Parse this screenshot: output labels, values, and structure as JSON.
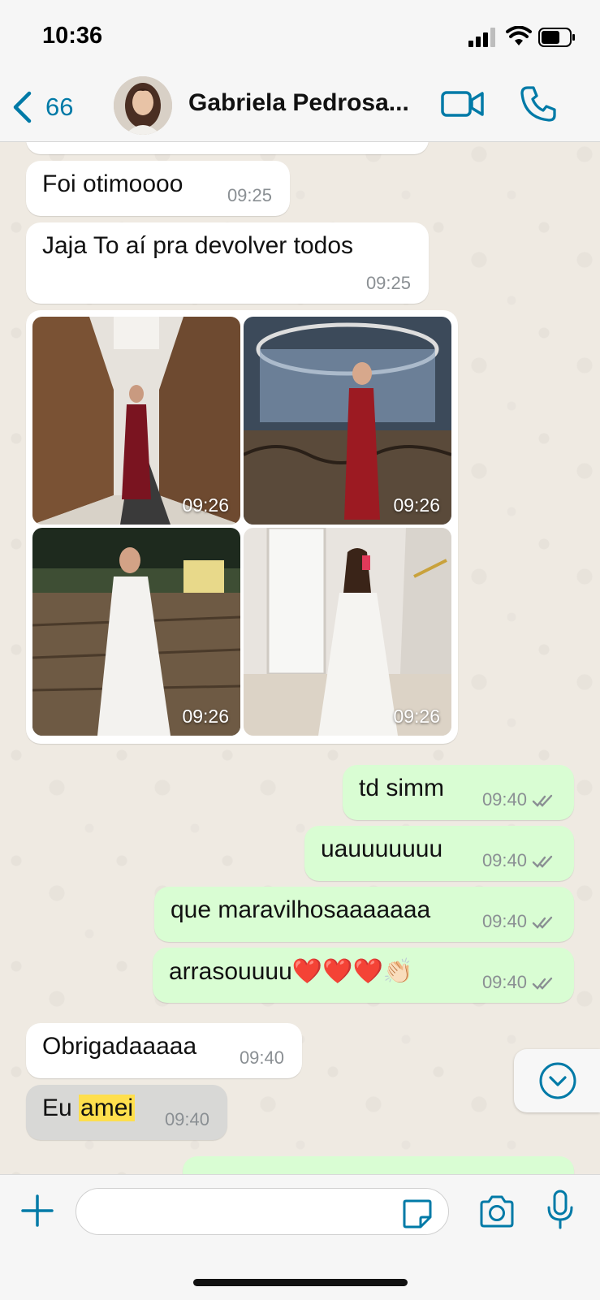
{
  "status_bar": {
    "time": "10:36"
  },
  "header": {
    "back_count": "66",
    "contact_name": "Gabriela Pedrosa..."
  },
  "messages": [
    {
      "direction": "in",
      "text": "Foi otimoooo",
      "time": "09:25"
    },
    {
      "direction": "in",
      "text": "Jaja To aí pra devolver todos",
      "time": "09:25"
    },
    {
      "direction": "in",
      "type": "photos",
      "times": [
        "09:26",
        "09:26",
        "09:26",
        "09:26"
      ]
    },
    {
      "direction": "out",
      "text": "td simm",
      "time": "09:40",
      "status": "read"
    },
    {
      "direction": "out",
      "text": "uauuuuuuu",
      "time": "09:40",
      "status": "read"
    },
    {
      "direction": "out",
      "text": "que maravilhosaaaaaaa",
      "time": "09:40",
      "status": "read"
    },
    {
      "direction": "out",
      "text": "arrasouuuu❤️❤️❤️👏🏻",
      "time": "09:40",
      "status": "read"
    },
    {
      "direction": "in",
      "text": "Obrigadaaaaa",
      "time": "09:40"
    },
    {
      "direction": "in",
      "text_before": "Eu ",
      "highlight": "amei",
      "time": "09:40"
    }
  ],
  "input": {
    "placeholder": ""
  },
  "colors": {
    "accent": "#007aa7",
    "outgoing_bubble": "#d9fdd3",
    "incoming_bubble": "#ffffff",
    "highlight": "#ffdf4d"
  },
  "icons": [
    "back-chevron-icon",
    "video-call-icon",
    "phone-icon",
    "chevron-down-circle-icon",
    "plus-icon",
    "sticker-icon",
    "camera-icon",
    "microphone-icon",
    "read-receipt-icon"
  ]
}
